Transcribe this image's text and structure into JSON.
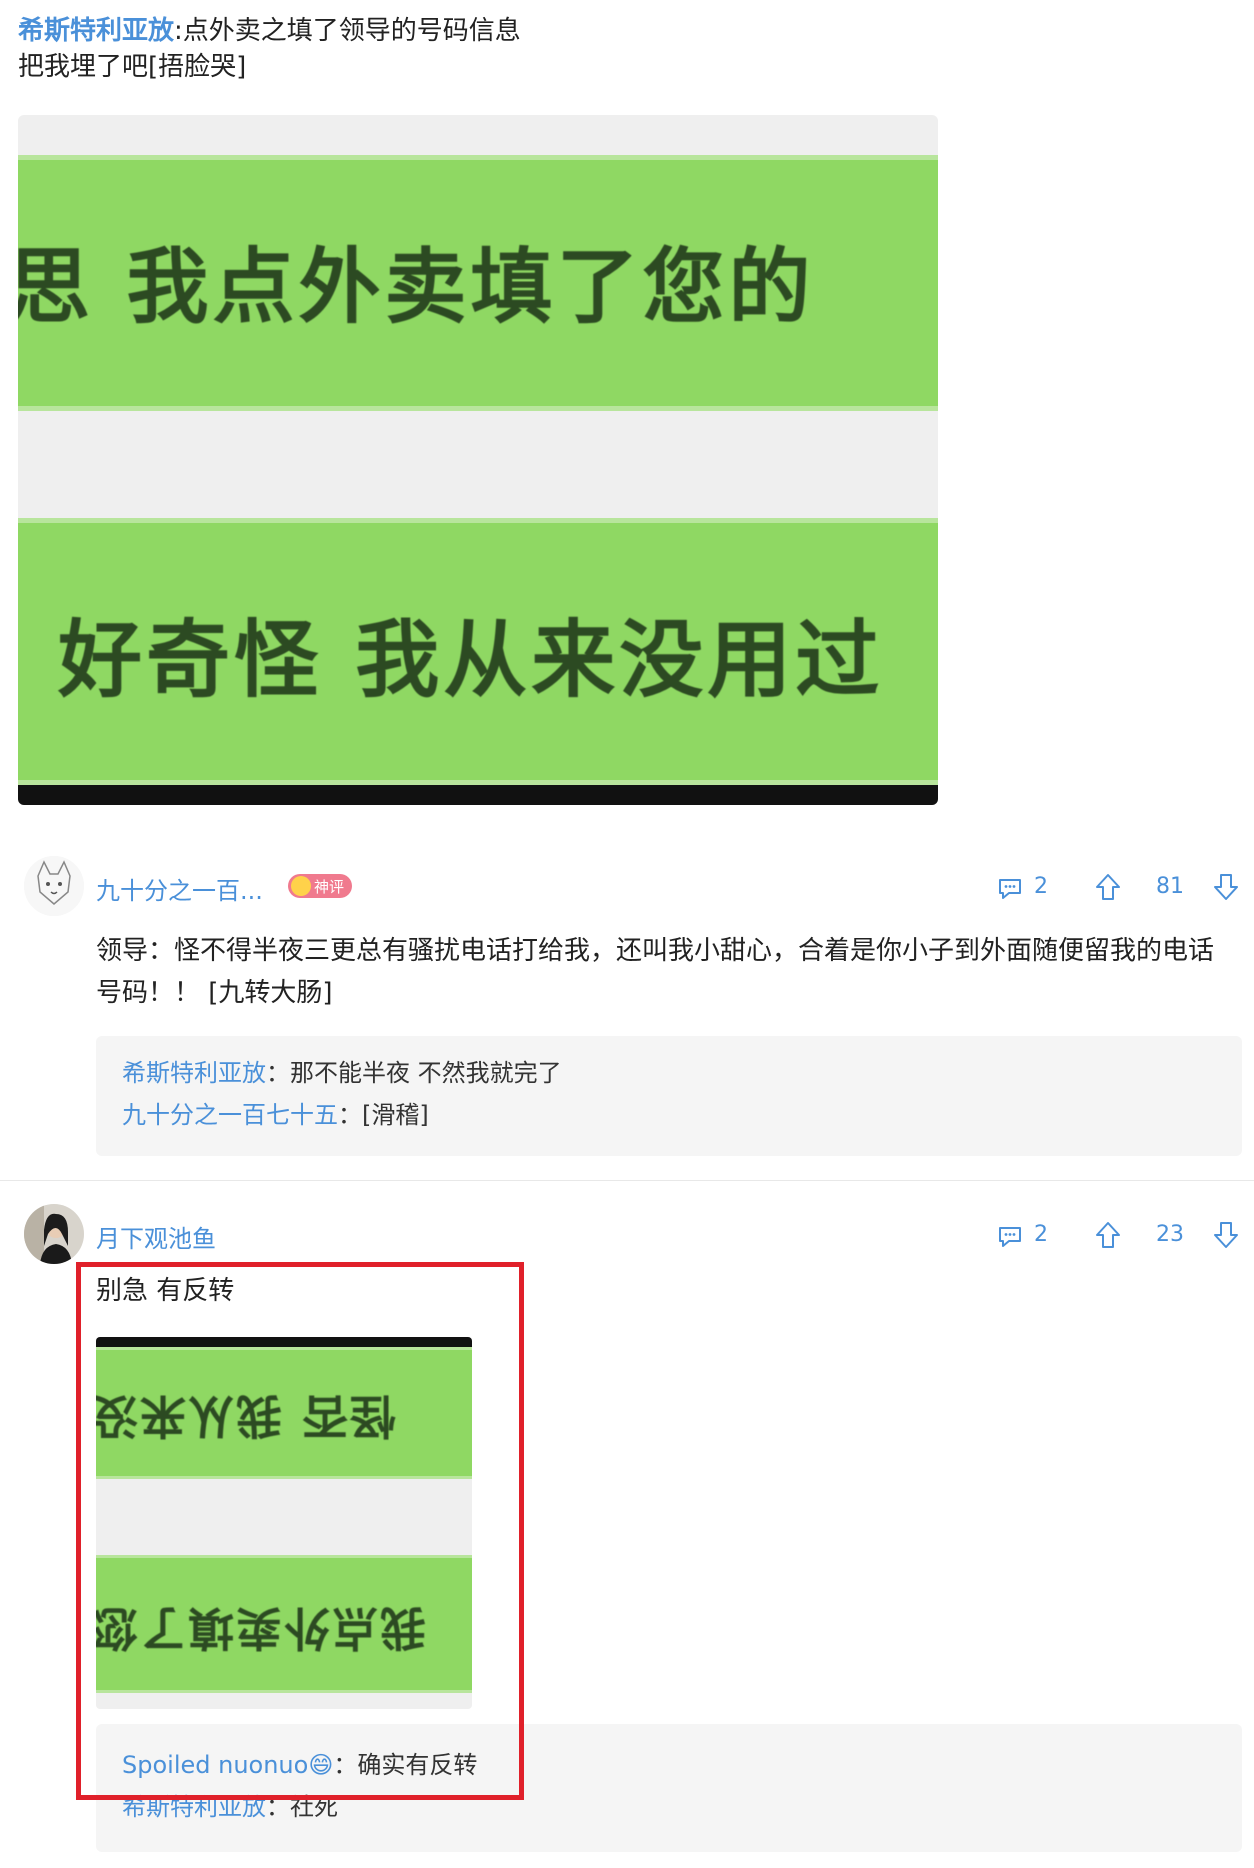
{
  "post": {
    "author": "希斯特利亚放",
    "text": ":点外卖之填了领导的号码信息",
    "line2": "把我埋了吧[捂脸哭]",
    "image": {
      "row1_text": "思  我点外卖填了您的",
      "row2_text": "好奇怪  我从来没用过"
    }
  },
  "comments": [
    {
      "name": "九十分之一百...",
      "badge": "神评",
      "avatar_icon": "cartoon-fox-avatar",
      "reply_count": "2",
      "up_count": "81",
      "body": "领导：怪不得半夜三更总有骚扰电话打给我，还叫我小甜心，合着是你小子到外面随便留我的电话号码！！ [九转大肠]",
      "replies": [
        {
          "name": "希斯特利亚放",
          "text": "：那不能半夜 不然我就完了"
        },
        {
          "name": "九十分之一百七十五",
          "text": "：[滑稽]"
        }
      ]
    },
    {
      "name": "月下观池鱼",
      "avatar_icon": "person-photo-avatar",
      "reply_count": "2",
      "up_count": "23",
      "body": "别急 有反转",
      "image": {
        "row1_text": "怪否  我从来没",
        "row2_text": "我点外卖填了您"
      },
      "replies": [
        {
          "name": "Spoiled nuonuo😄",
          "text": "：确实有反转"
        },
        {
          "name": "希斯特利亚放",
          "text": "：社死"
        }
      ]
    }
  ],
  "colors": {
    "link_blue": "#4a90d9",
    "bubble_green": "#8fd863",
    "highlight_red": "#e0202a",
    "badge_pink": "#f07a8e"
  }
}
